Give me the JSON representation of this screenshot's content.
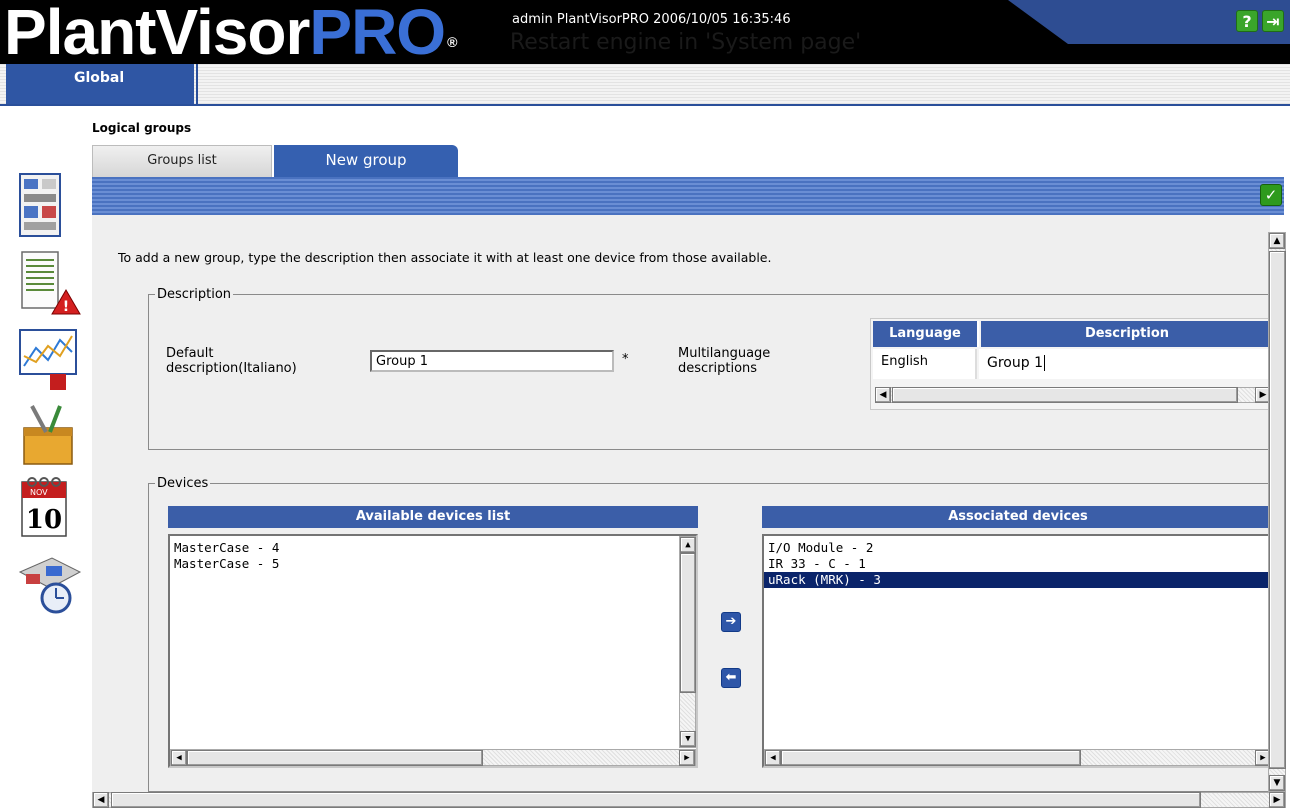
{
  "header": {
    "logo_plant": "PlantVisor",
    "logo_pro": "PRO",
    "logo_reg": "®",
    "info": "admin PlantVisorPRO 2006/10/05 16:35:46",
    "message": "Restart engine in 'System page'",
    "help_glyph": "?",
    "exit_glyph": "⇥"
  },
  "nav": {
    "global_label": "Global"
  },
  "page": {
    "section_title": "Logical groups",
    "tabs": [
      {
        "label": "Groups list",
        "active": false
      },
      {
        "label": "New group",
        "active": true
      }
    ],
    "confirm_glyph": "✓",
    "instructions": "To add a new group, type the description then associate it with at least one device from those available."
  },
  "description": {
    "legend": "Description",
    "default_label": "Default description(Italiano)",
    "default_value": "Group 1",
    "required_mark": "*",
    "multilanguage_label": "Multilanguage descriptions",
    "grid": {
      "columns": [
        "Language",
        "Description"
      ],
      "rows": [
        {
          "language": "English",
          "description": "Group 1"
        }
      ]
    }
  },
  "devices": {
    "legend": "Devices",
    "available_title": "Available devices list",
    "associated_title": "Associated devices",
    "available": [
      "MasterCase - 4",
      "MasterCase - 5"
    ],
    "associated": [
      "I/O Module - 2",
      "IR 33 - C - 1",
      "uRack (MRK) - 3"
    ],
    "selected_associated": "uRack (MRK) - 3",
    "add_glyph": "➔",
    "remove_glyph": "⬅"
  },
  "side_icons": [
    "plant-layout-icon",
    "alarm-report-icon",
    "graph-icon",
    "tools-box-icon",
    "calendar-icon",
    "scheduler-icon"
  ],
  "calendar": {
    "month": "NOV",
    "day": "10"
  },
  "colors": {
    "accent": "#3560b0",
    "header_bg": "#000000",
    "logo_blue": "#3a6fd6",
    "selection": "#0a246a",
    "confirm": "#2e9a1d"
  }
}
